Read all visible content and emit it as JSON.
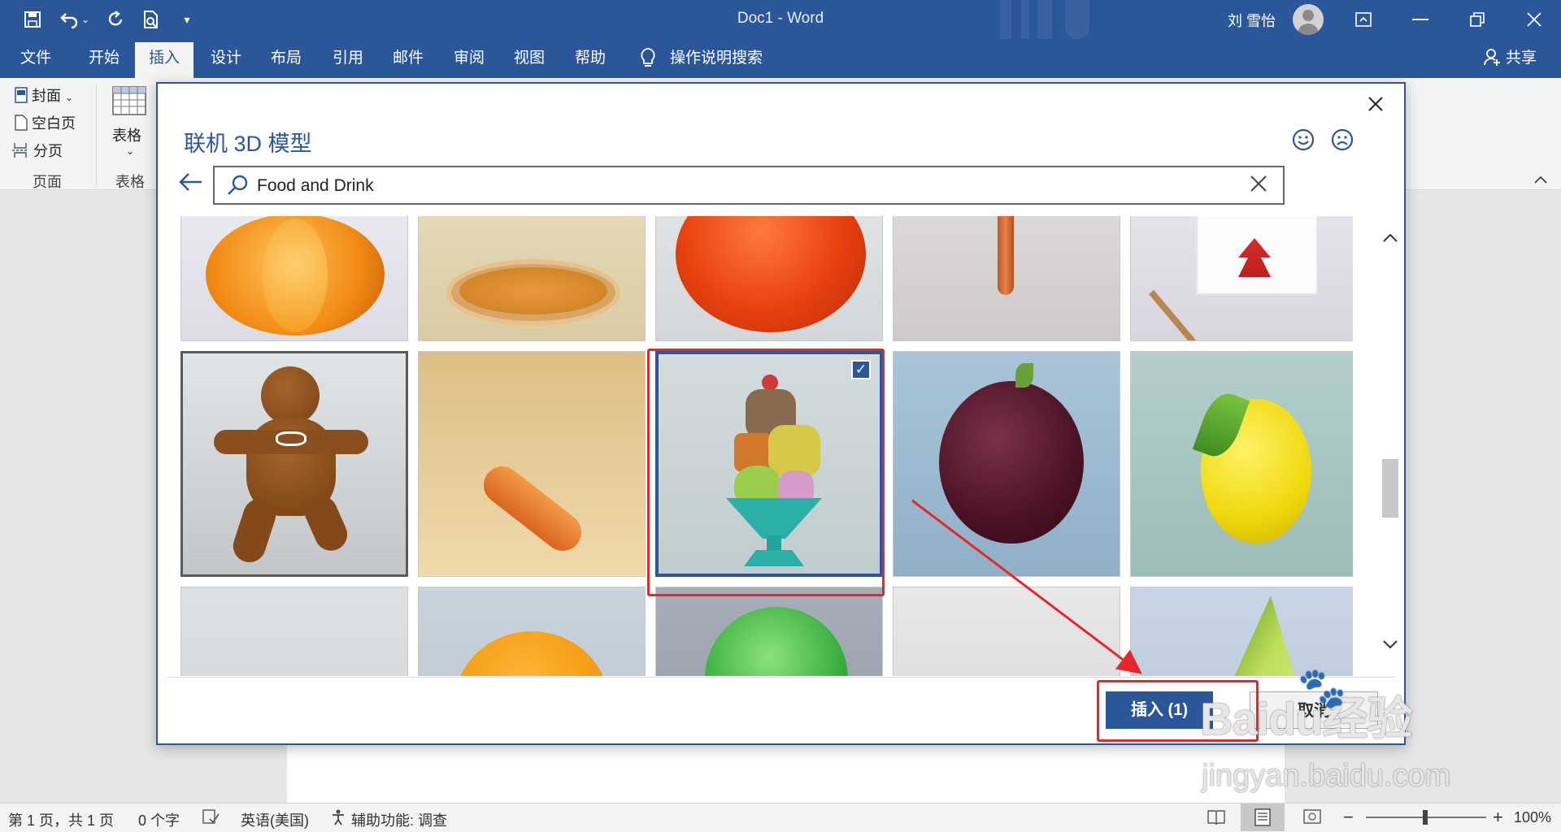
{
  "titlebar": {
    "title": "Doc1  -  Word",
    "user_name": "刘 雪怡",
    "icons": [
      "save-icon",
      "undo-icon",
      "redo-icon",
      "print-preview-icon",
      "customize-icon"
    ]
  },
  "tabs": [
    {
      "label": "文件"
    },
    {
      "label": "开始"
    },
    {
      "label": "插入",
      "active": true
    },
    {
      "label": "设计"
    },
    {
      "label": "布局"
    },
    {
      "label": "引用"
    },
    {
      "label": "邮件"
    },
    {
      "label": "审阅"
    },
    {
      "label": "视图"
    },
    {
      "label": "帮助"
    }
  ],
  "tell_me": "操作说明搜索",
  "share": "共享",
  "ribbon": {
    "pages_items": [
      "封面",
      "空白页",
      "分页"
    ],
    "pages_group": "页面",
    "table_label": "表格",
    "table_group": "表格"
  },
  "dialog": {
    "title": "联机 3D 模型",
    "search_value": "Food and Drink",
    "insert_label": "插入 (1)",
    "cancel_label": "取消",
    "models": [
      {
        "subject": "pumpkin"
      },
      {
        "subject": "pie"
      },
      {
        "subject": "tomato"
      },
      {
        "subject": "carrot"
      },
      {
        "subject": "takeout-box"
      },
      {
        "subject": "gingerbread-man",
        "focused": true
      },
      {
        "subject": "baguette"
      },
      {
        "subject": "ice-cream-sundae",
        "selected": true
      },
      {
        "subject": "plum"
      },
      {
        "subject": "lemon"
      },
      {
        "subject": "burger-bun"
      },
      {
        "subject": "green-ball"
      },
      {
        "subject": "blank"
      },
      {
        "subject": "avocado"
      },
      {
        "subject": "plain"
      }
    ]
  },
  "status": {
    "page": "第 1 页，共 1 页",
    "words": "0 个字",
    "language": "英语(美国)",
    "accessibility": "辅助功能: 调查",
    "zoom": "100%"
  },
  "watermark": {
    "logo": "Baidu经验",
    "url": "jingyan.baidu.com"
  },
  "colors": {
    "accent": "#2b579a",
    "annotation": "#e8262a"
  }
}
